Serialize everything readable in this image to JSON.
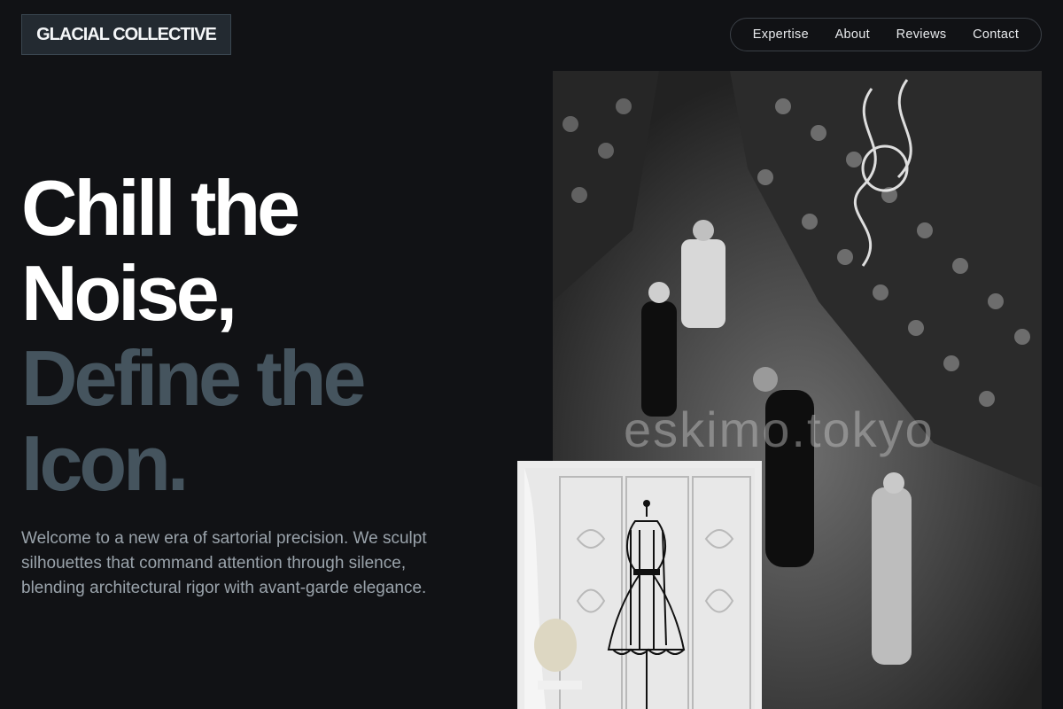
{
  "header": {
    "logo": "GLACIAL COLLECTIVE",
    "nav": [
      {
        "label": "Expertise"
      },
      {
        "label": "About"
      },
      {
        "label": "Reviews"
      },
      {
        "label": "Contact"
      }
    ]
  },
  "hero": {
    "headline_white": [
      "Chill the",
      "Noise,"
    ],
    "headline_accent": [
      "Define the",
      "Icon."
    ],
    "intro": "Welcome to a new era of sartorial precision. We sculpt silhouettes that command attention through silence, blending architectural rigor with avant-garde elegance.",
    "runway_watermark": "eskimo.tokyo"
  },
  "colors": {
    "background": "#111215",
    "accent_text": "#45545e",
    "body_text": "#9aa3ab",
    "logo_bg": "#232a31"
  },
  "icons": [
    "runway-photo",
    "mannequin-photo"
  ]
}
